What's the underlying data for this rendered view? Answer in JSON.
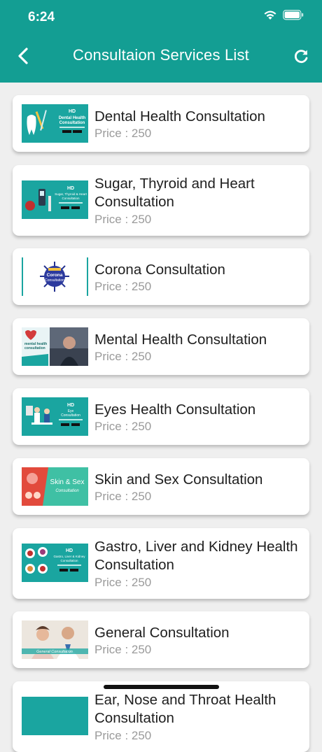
{
  "status_bar": {
    "time": "6:24"
  },
  "header": {
    "title": "Consultaion Services List",
    "back_icon": "chevron-left-icon",
    "refresh_icon": "refresh-icon",
    "background": "#139e93"
  },
  "services": [
    {
      "title": "Dental Health Consultation",
      "price": "Price : 250",
      "thumb_label": "Dental Health Consultation"
    },
    {
      "title": "Sugar, Thyroid and Heart Consultation",
      "price": "Price : 250",
      "thumb_label": "Sugar, Thyroid & Heart Consultation"
    },
    {
      "title": "Corona Consultation",
      "price": "Price : 250",
      "thumb_label": "Corona Consultation"
    },
    {
      "title": "Mental Health Consultation",
      "price": "Price : 250",
      "thumb_label": "Mental health consultation"
    },
    {
      "title": "Eyes Health Consultation",
      "price": "Price : 250",
      "thumb_label": "Eye Consultation"
    },
    {
      "title": "Skin and Sex Consultation",
      "price": "Price : 250",
      "thumb_label": "Skin & Sex"
    },
    {
      "title": "Gastro, Liver and Kidney Health Consultation",
      "price": "Price : 250",
      "thumb_label": "Gastro, Liver & Kidney Consultation"
    },
    {
      "title": "General Consultation",
      "price": "Price : 250",
      "thumb_label": "General Consultation"
    },
    {
      "title": "Ear, Nose and Throat Health Consultation",
      "price": "Price : 250",
      "thumb_label": ""
    }
  ]
}
